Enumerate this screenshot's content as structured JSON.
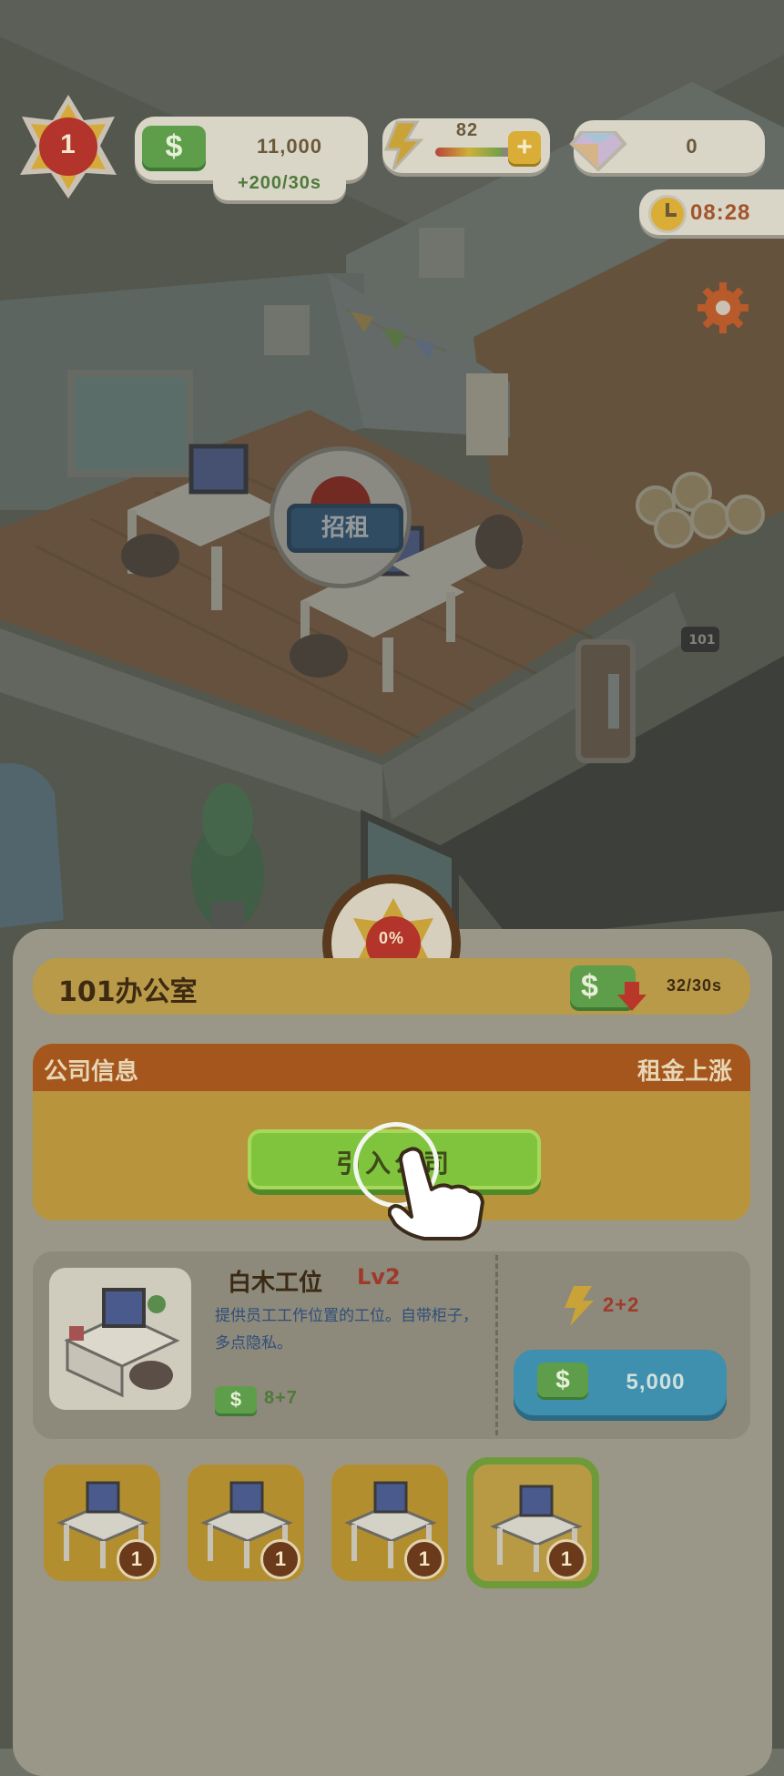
{
  "hud": {
    "level": "1",
    "money": "11,000",
    "income_rate": "+200/30s",
    "energy_value": "82",
    "energy_fill": 0.8,
    "gems": "0",
    "clock": "08:28"
  },
  "world": {
    "rent_sign": "招租",
    "door_plate": "101"
  },
  "panel": {
    "progress": "0%",
    "room_name": "101办公室",
    "rent_rate": "32/30s",
    "company_section_label": "公司信息",
    "rent_up_label": "租金上涨",
    "invite_button": "引入公司",
    "item": {
      "name": "白木工位",
      "level": "Lv2",
      "description": "提供员工工作位置的工位。自带柜子，多点隐私。",
      "income": "8+7",
      "energy": "2+2",
      "price": "5,000"
    },
    "slots": [
      {
        "badge": "1"
      },
      {
        "badge": "1"
      },
      {
        "badge": "1"
      },
      {
        "badge": "1"
      }
    ]
  },
  "colors": {
    "green_button": "#7fc43c",
    "header_bar": "#b89a48",
    "orange_strip": "#a4561c",
    "price_button": "#3f8fae",
    "red_flower": "#c13a2a",
    "star_yellow": "#e8b83a"
  }
}
